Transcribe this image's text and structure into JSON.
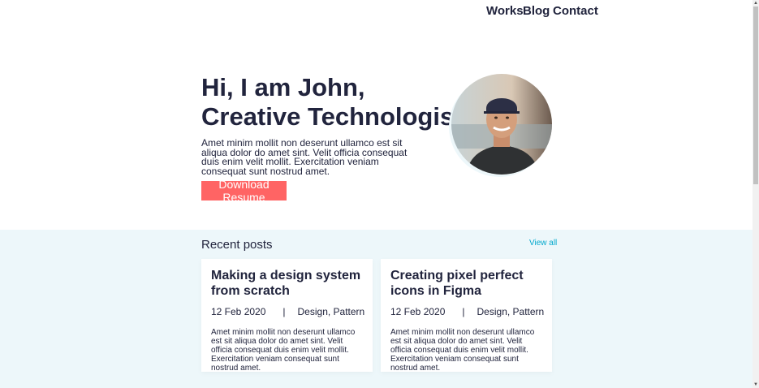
{
  "nav": {
    "items": [
      "Works",
      "Blog",
      "Contact"
    ]
  },
  "hero": {
    "line1": "Hi, I am John,",
    "line2": "Creative Technologist",
    "text": "Amet minim mollit non deserunt ullamco est sit aliqua dolor do amet sint. Velit officia consequat duis enim velit mollit. Exercitation veniam consequat sunt nostrud amet.",
    "button": "Download Resume"
  },
  "recent": {
    "title": "Recent posts",
    "view_all": "View all",
    "posts": [
      {
        "title": "Making a design system from scratch",
        "date": "12 Feb 2020",
        "sep": "|",
        "tags": "Design, Pattern",
        "excerpt": "Amet minim mollit non deserunt ullamco est sit aliqua dolor do amet sint. Velit officia consequat duis enim velit mollit. Exercitation veniam consequat sunt nostrud amet."
      },
      {
        "title": "Creating pixel perfect icons in Figma",
        "date": "12 Feb 2020",
        "sep": "|",
        "tags": "Design, Pattern",
        "excerpt": "Amet minim mollit non deserunt ullamco est sit aliqua dolor do amet sint. Velit officia consequat duis enim velit mollit. Exercitation veniam consequat sunt nostrud amet."
      }
    ]
  },
  "colors": {
    "text": "#21243d",
    "accent": "#ff6464",
    "link": "#00a8cc",
    "section_bg": "#edf7fa"
  }
}
